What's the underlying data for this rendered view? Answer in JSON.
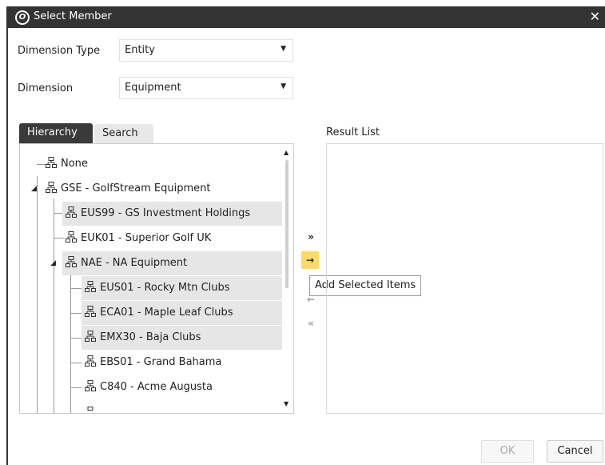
{
  "window": {
    "title": "Select Member",
    "close_glyph": "✕",
    "logo_glyph": "O"
  },
  "fields": {
    "dimension_type": {
      "label": "Dimension Type",
      "value": "Entity"
    },
    "dimension": {
      "label": "Dimension",
      "value": "Equipment"
    }
  },
  "tabs": [
    {
      "label": "Hierarchy",
      "active": true
    },
    {
      "label": "Search",
      "active": false
    }
  ],
  "tree": {
    "items": [
      {
        "label": "None",
        "selected": false,
        "expanded": null
      },
      {
        "label": "GSE - GolfStream Equipment",
        "selected": false,
        "expanded": true
      },
      {
        "label": "EUS99 - GS Investment Holdings",
        "selected": true,
        "expanded": null
      },
      {
        "label": "EUK01 - Superior Golf UK",
        "selected": false,
        "expanded": null
      },
      {
        "label": "NAE - NA Equipment",
        "selected": true,
        "expanded": true
      },
      {
        "label": "EUS01 - Rocky Mtn Clubs",
        "selected": true,
        "expanded": null
      },
      {
        "label": "ECA01 - Maple Leaf Clubs",
        "selected": true,
        "expanded": null
      },
      {
        "label": "EMX30 - Baja Clubs",
        "selected": true,
        "expanded": null
      },
      {
        "label": "EBS01 - Grand Bahama",
        "selected": false,
        "expanded": null
      },
      {
        "label": "C840 - Acme Augusta",
        "selected": false,
        "expanded": null
      }
    ]
  },
  "result_list": {
    "label": "Result List",
    "items": []
  },
  "move_buttons": {
    "add_all_glyph": "»",
    "add_selected_glyph": "→",
    "remove_selected_glyph": "←",
    "remove_all_glyph": "«",
    "tooltip": "Add Selected Items"
  },
  "footer": {
    "ok_label": "OK",
    "cancel_label": "Cancel"
  },
  "colors": {
    "titlebar": "#333333",
    "selected_row": "#e6e6e6",
    "active_button": "#ffd966"
  }
}
